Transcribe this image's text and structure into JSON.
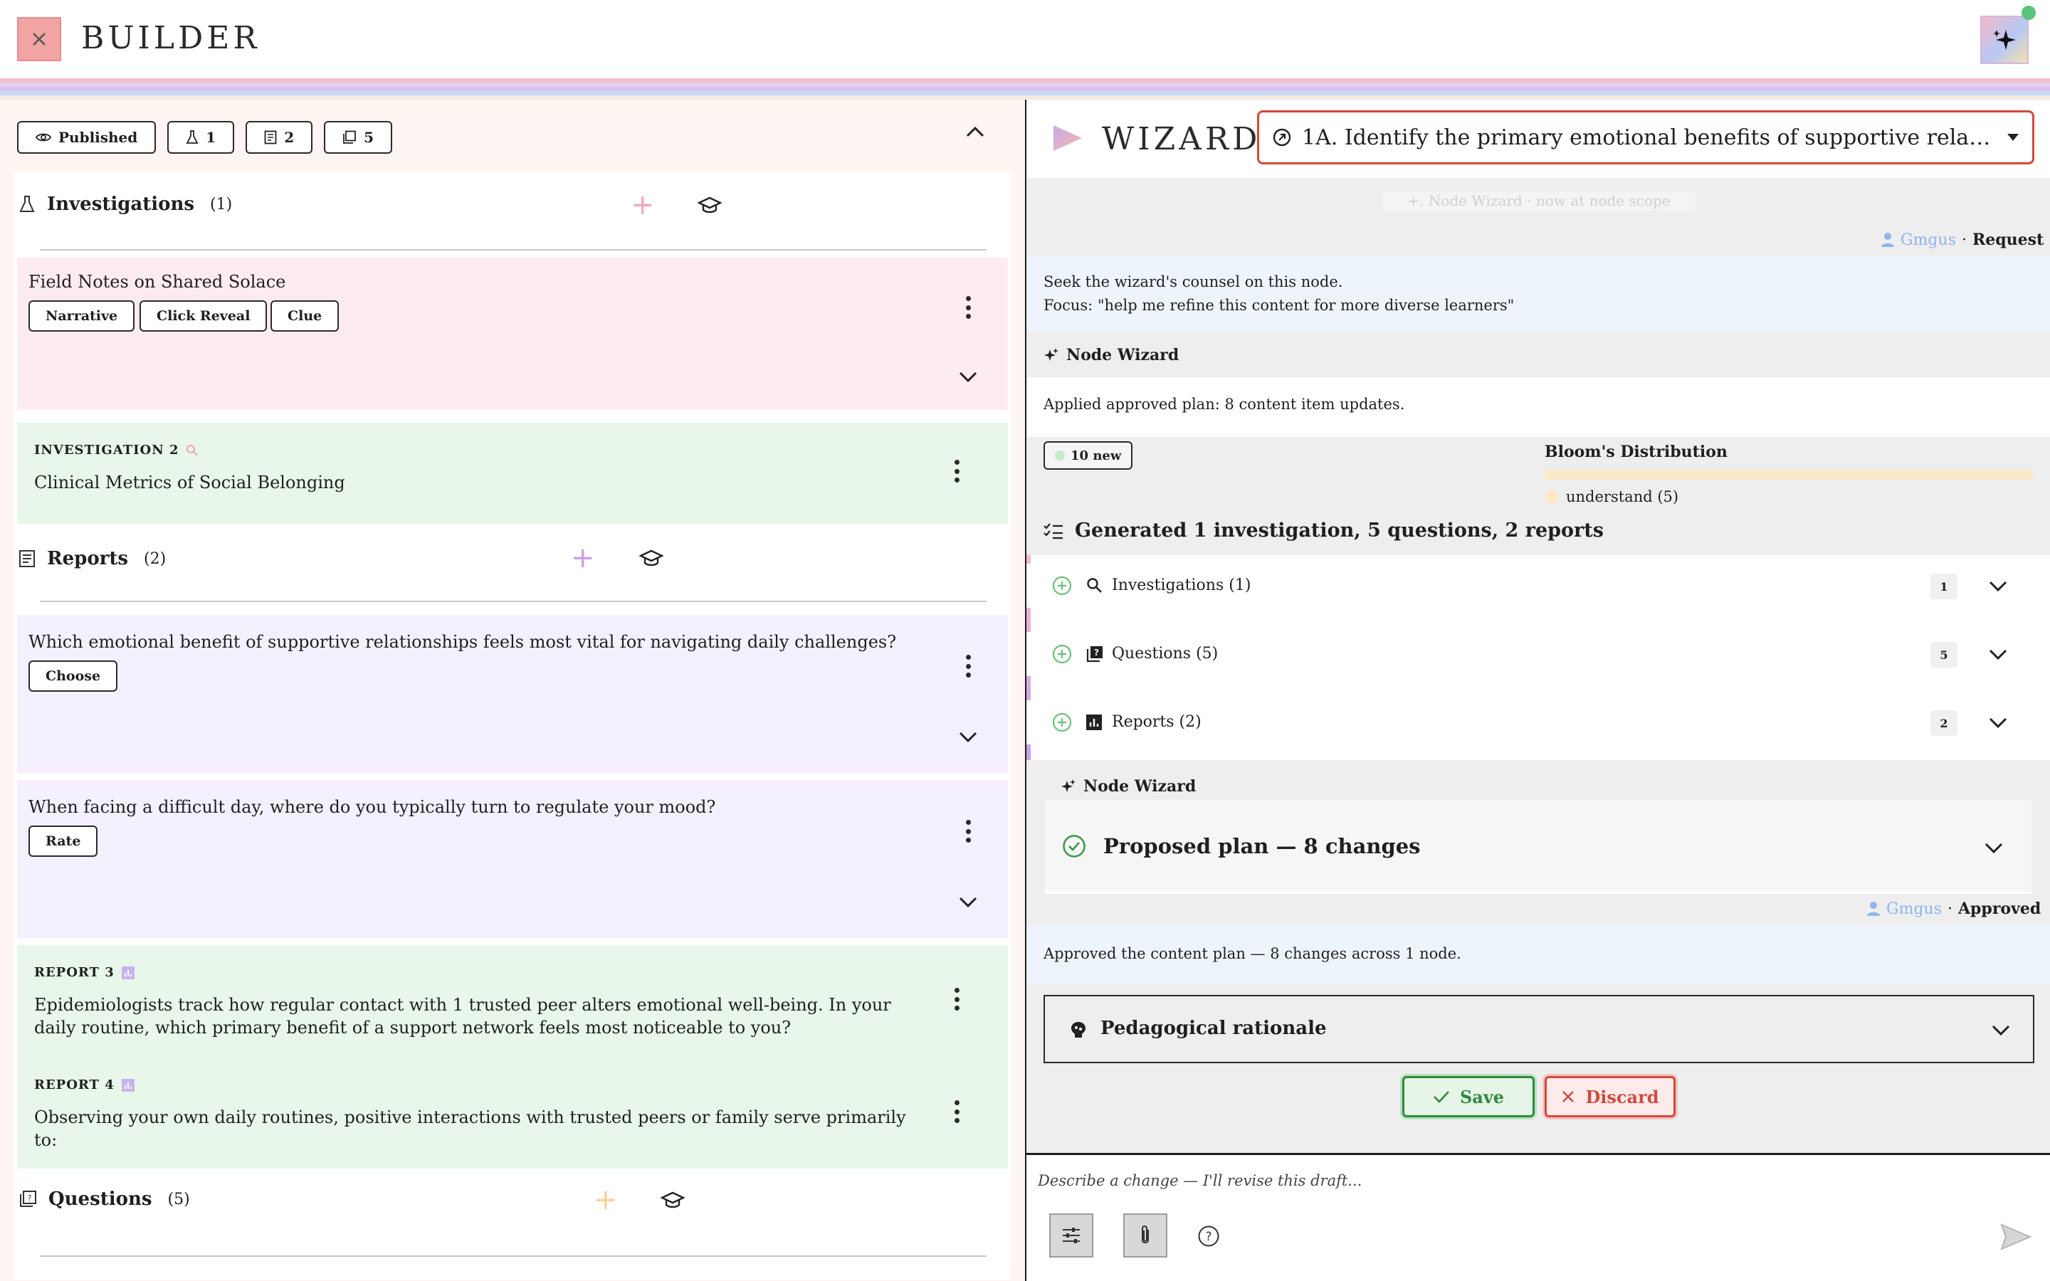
{
  "app": {
    "brand": "BUILDER"
  },
  "left": {
    "chips": [
      {
        "label": "Published"
      },
      {
        "label": "1"
      },
      {
        "label": "2"
      },
      {
        "label": "5"
      }
    ],
    "investigations": {
      "title": "Investigations",
      "count": "(1)",
      "cards": [
        {
          "title": "Field Notes on Shared Solace",
          "tags": [
            "Narrative",
            "Click Reveal",
            "Clue"
          ]
        },
        {
          "overline": "INVESTIGATION 2",
          "title": "Clinical Metrics of Social Belonging"
        }
      ]
    },
    "reports": {
      "title": "Reports",
      "count": "(2)",
      "cards": [
        {
          "title": "Which emotional benefit of supportive relationships feels most vital for navigating daily challenges?",
          "tag": "Choose"
        },
        {
          "title": "When facing a difficult day, where do you typically turn to regulate your mood?",
          "tag": "Rate"
        },
        {
          "overline": "REPORT 3",
          "title": "Epidemiologists track how regular contact with 1 trusted peer alters emotional well-being. In your daily routine, which primary benefit of a support network feels most noticeable to you?"
        },
        {
          "overline": "REPORT 4",
          "title": "Observing your own daily routines, positive interactions with trusted peers or family serve primarily to:"
        }
      ]
    },
    "questions": {
      "title": "Questions",
      "count": "(5)"
    }
  },
  "wizard": {
    "title": "WIZARD",
    "node_selector": "1A. Identify the primary emotional benefits of supportive relat...",
    "faint_top": "+. Node Wizard · now at node scope",
    "request": {
      "user": "Gmgus",
      "sep": "·",
      "kind": "Request",
      "line1": "Seek the wizard's counsel on this node.",
      "line2": "Focus: \"help me refine this content for more diverse learners\""
    },
    "node_wizard_label": "Node Wizard",
    "applied": "Applied approved plan: 8 content item updates.",
    "new_chip": "10 new",
    "bloom": {
      "title": "Bloom's Distribution",
      "legend": "understand (5)",
      "understand_share": 1.0
    },
    "generated": "Generated 1 investigation, 5 questions, 2 reports",
    "gen_rows": [
      {
        "label": "Investigations (1)",
        "count": "1",
        "icon": "search-icon"
      },
      {
        "label": "Questions (5)",
        "count": "5",
        "icon": "question-icon"
      },
      {
        "label": "Reports (2)",
        "count": "2",
        "icon": "bar-chart-icon"
      }
    ],
    "plan_title": "Proposed plan — 8 changes",
    "approved": {
      "user": "Gmgus",
      "sep": "·",
      "kind": "Approved",
      "text": "Approved the content plan — 8 changes across 1 node."
    },
    "rationale": "Pedagogical rationale",
    "save": "Save",
    "discard": "Discard",
    "composer_placeholder": "Describe a change — I'll revise this draft...",
    "colors": {
      "accent_red": "#d14a3e",
      "save_green": "#2f8a3c",
      "bloom_bar": "#fbe9c8"
    }
  }
}
